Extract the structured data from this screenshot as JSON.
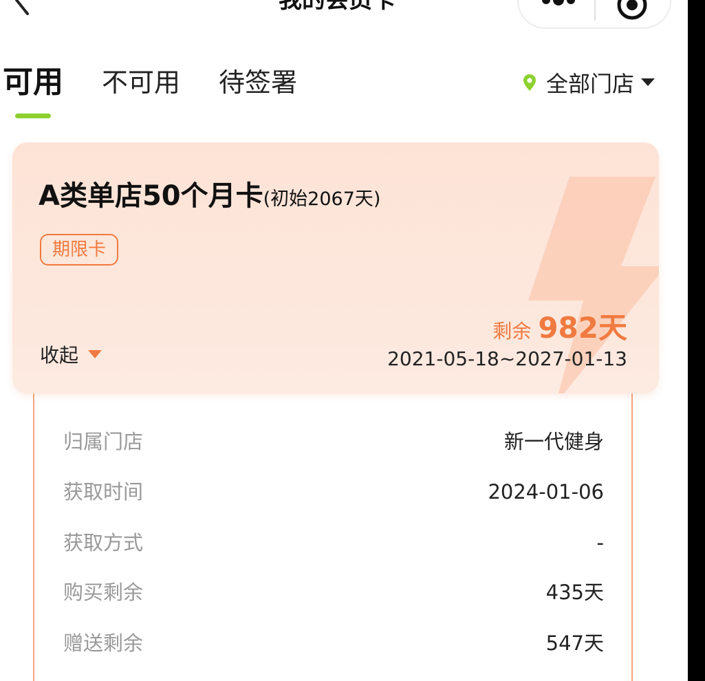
{
  "header": {
    "title": "我的会员卡"
  },
  "tabs": [
    {
      "label": "可用",
      "active": true
    },
    {
      "label": "不可用",
      "active": false
    },
    {
      "label": "待签署",
      "active": false
    }
  ],
  "store_filter": {
    "label": "全部门店",
    "icon": "location-pin-icon"
  },
  "card": {
    "name": "A类单店50个月卡",
    "initial": "(初始2067天)",
    "tag": "期限卡",
    "collapse_label": "收起",
    "remaining_prefix": "剩余",
    "remaining_value": "982天",
    "validity": "2021-05-18~2027-01-13"
  },
  "details": [
    {
      "label": "归属门店",
      "value": "新一代健身"
    },
    {
      "label": "获取时间",
      "value": "2024-01-06"
    },
    {
      "label": "获取方式",
      "value": "-"
    },
    {
      "label": "购买剩余",
      "value": "435天"
    },
    {
      "label": "赠送剩余",
      "value": "547天"
    }
  ],
  "colors": {
    "accent": "#f07a3f",
    "tab_indicator": "#8ed12f",
    "card_bg": "#fde5d9",
    "location_pin": "#8ed12f"
  }
}
